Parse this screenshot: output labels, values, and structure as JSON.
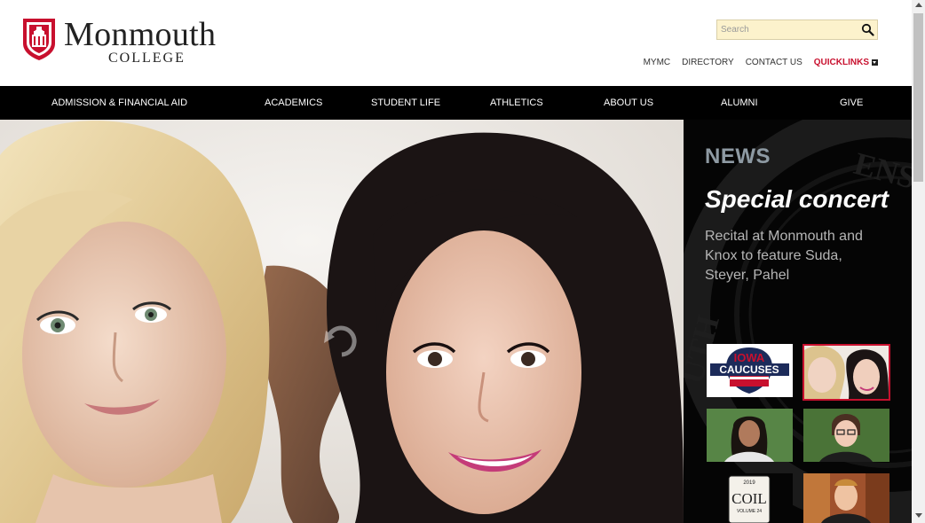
{
  "logo": {
    "title": "Monmouth",
    "subtitle": "COLLEGE"
  },
  "search": {
    "placeholder": "Search"
  },
  "utility_links": [
    "MYMC",
    "DIRECTORY",
    "CONTACT US"
  ],
  "quicklinks_label": "QUICKLINKS",
  "nav": [
    "ADMISSION & FINANCIAL AID",
    "ACADEMICS",
    "STUDENT LIFE",
    "ATHLETICS",
    "ABOUT US",
    "ALUMNI",
    "GIVE"
  ],
  "news": {
    "label": "NEWS",
    "title": "Special concert",
    "text": "Recital at Monmouth and Knox to feature Suda, Steyer, Pahel"
  },
  "thumbnails": {
    "iowa": {
      "line1": "IOWA",
      "line2": "CAUCUSES"
    },
    "coil": {
      "year": "2019",
      "title": "COIL",
      "volume": "VOLUME 24"
    }
  },
  "colors": {
    "brand_red": "#c8102e",
    "nav_bg": "#000000",
    "search_bg": "#fcf2cc"
  }
}
